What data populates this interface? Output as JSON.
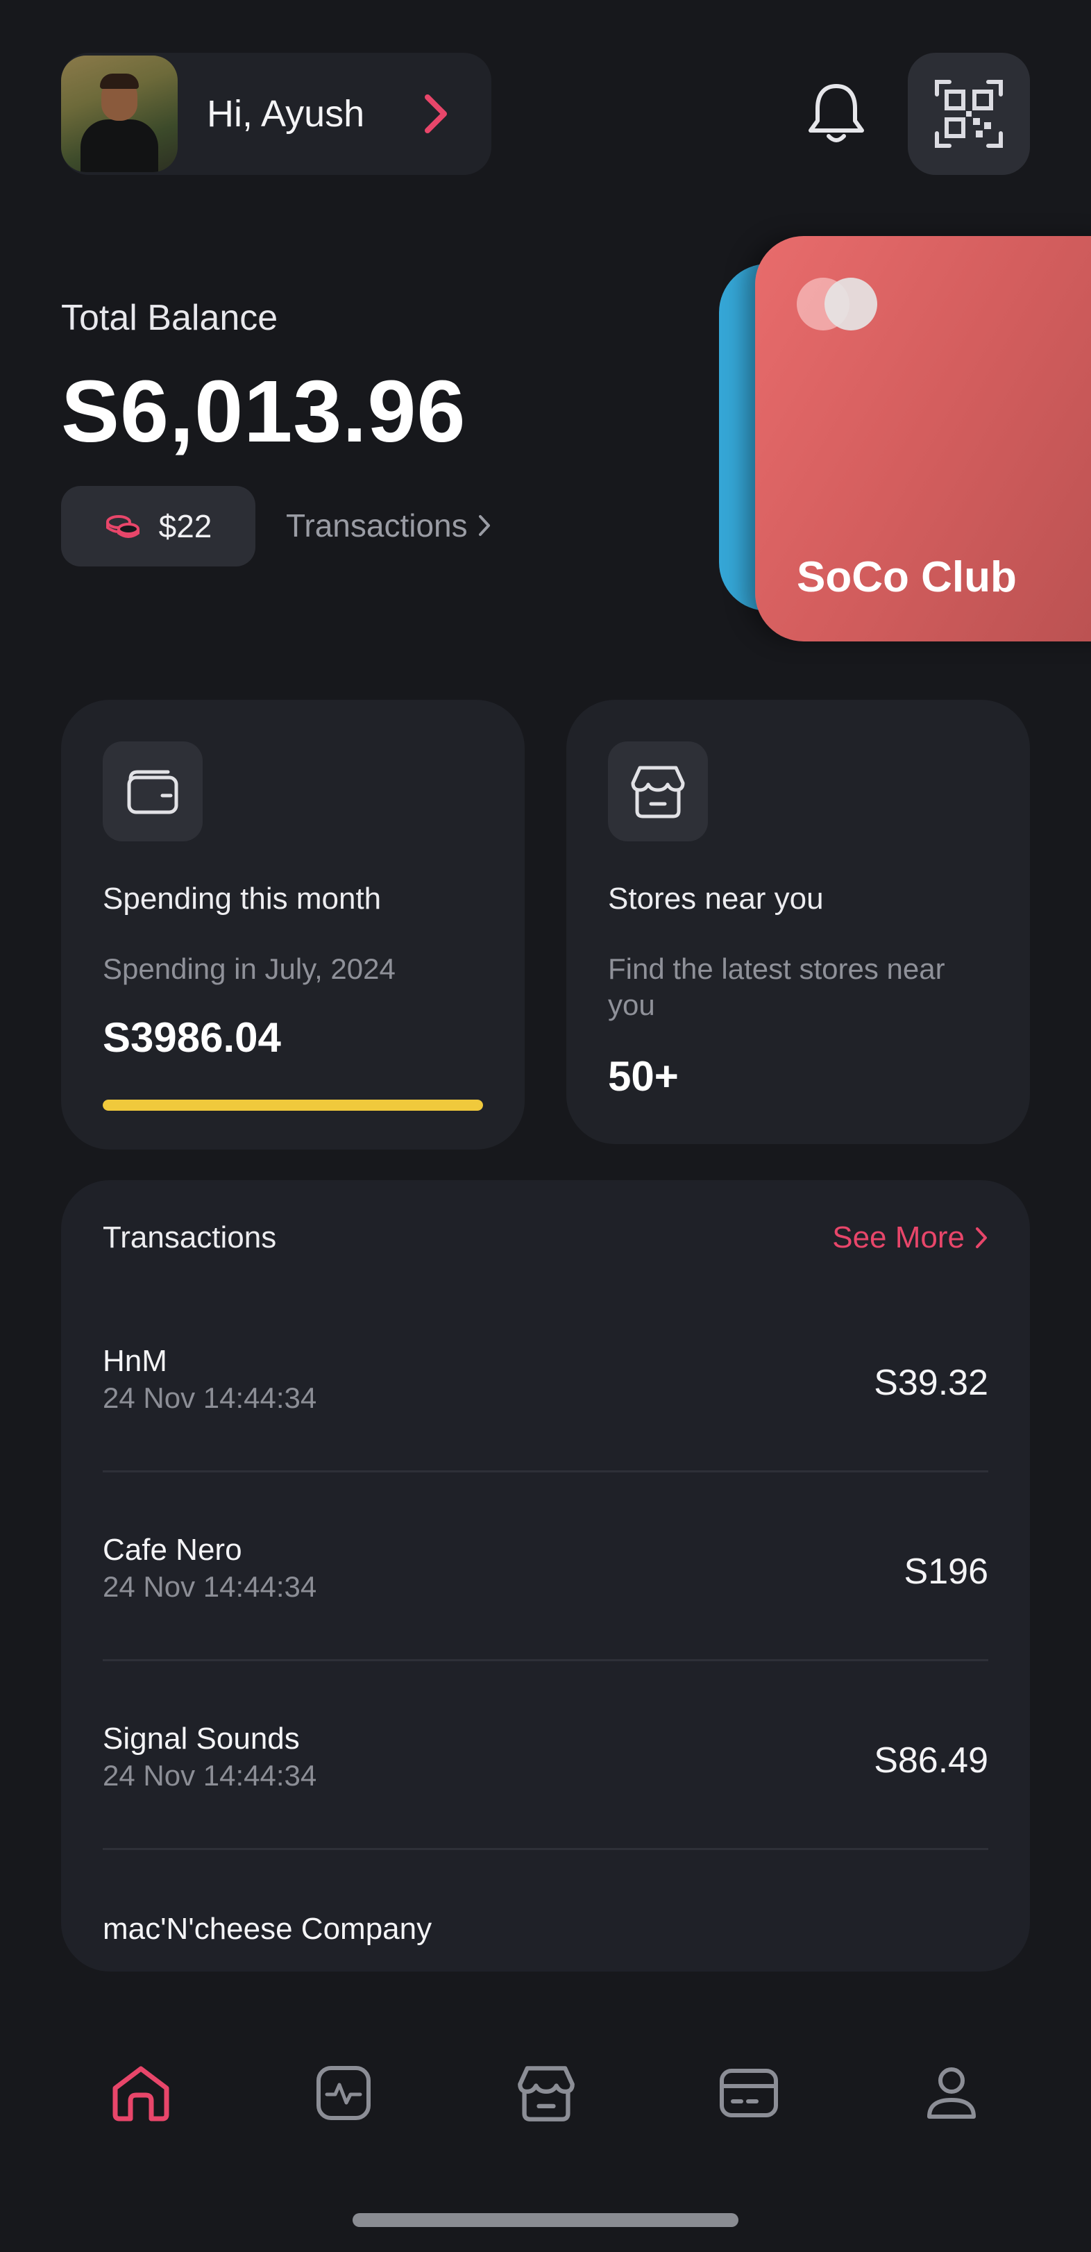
{
  "header": {
    "greeting": "Hi, Ayush",
    "accent": "#e8466a"
  },
  "balance": {
    "label": "Total Balance",
    "amount": "S6,013.96",
    "coins": "$22",
    "transactions_link": "Transactions"
  },
  "card": {
    "name": "SoCo Club",
    "front_color": "#e06464",
    "back_color": "#35a6d6"
  },
  "spending": {
    "title": "Spending this month",
    "subtitle": "Spending in July, 2024",
    "amount": "S3986.04",
    "progress": 1.0,
    "bar_color": "#f0c93c"
  },
  "stores": {
    "title": "Stores near you",
    "subtitle": "Find the latest stores near you",
    "count": "50+"
  },
  "transactions": {
    "title": "Transactions",
    "see_more": "See More",
    "items": [
      {
        "name": "HnM",
        "time": "24 Nov 14:44:34",
        "amount": "S39.32"
      },
      {
        "name": "Cafe Nero",
        "time": "24 Nov 14:44:34",
        "amount": "S196"
      },
      {
        "name": "Signal Sounds",
        "time": "24 Nov 14:44:34",
        "amount": "S86.49"
      },
      {
        "name": "mac'N'cheese Company",
        "time": "",
        "amount": ""
      }
    ]
  },
  "nav": {
    "items": [
      "home-icon",
      "activity-icon",
      "store-icon",
      "card-icon",
      "profile-icon"
    ],
    "active_color": "#e8466a",
    "inactive_color": "#8c8e96"
  }
}
